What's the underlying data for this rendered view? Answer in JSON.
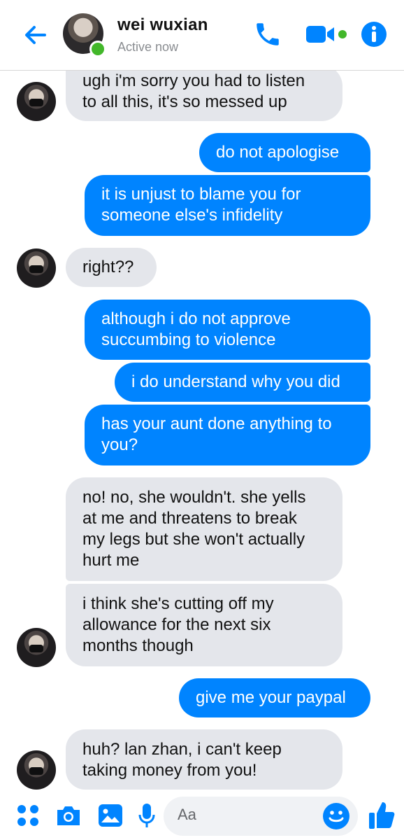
{
  "header": {
    "contact_name": "wei wuxian",
    "status": "Active now",
    "back_icon": "arrow-left-icon",
    "call_icon": "phone-icon",
    "video_icon": "video-camera-icon",
    "info_icon": "info-icon"
  },
  "colors": {
    "accent": "#0084ff",
    "incoming_bubble": "#e4e6eb",
    "online": "#42b72a"
  },
  "messages": [
    {
      "dir": "in",
      "text": "ugh i'm sorry you had to listen\nto all this, it's so messed up"
    },
    {
      "dir": "out",
      "text": "do not apologise"
    },
    {
      "dir": "out",
      "text": "it is unjust to blame you for\nsomeone else's infidelity"
    },
    {
      "dir": "in",
      "text": "right??"
    },
    {
      "dir": "out",
      "text": "although i do not approve\nsuccumbing to violence"
    },
    {
      "dir": "out",
      "text": "i do understand why you did"
    },
    {
      "dir": "out",
      "text": "has your aunt done anything to\nyou?"
    },
    {
      "dir": "in",
      "text": "no! no, she wouldn't. she yells\nat me and threatens to break\nmy legs but she won't actually\nhurt me"
    },
    {
      "dir": "in",
      "text": "i think she's cutting off my\nallowance for the next six\nmonths though"
    },
    {
      "dir": "out",
      "text": "give me your paypal"
    },
    {
      "dir": "in",
      "text": "huh? lan zhan, i can't keep\ntaking money from you!"
    }
  ],
  "composer": {
    "placeholder": "Aa",
    "icons": [
      "more-apps-icon",
      "camera-icon",
      "gallery-icon",
      "microphone-icon",
      "emoji-icon",
      "thumbs-up-icon"
    ]
  }
}
